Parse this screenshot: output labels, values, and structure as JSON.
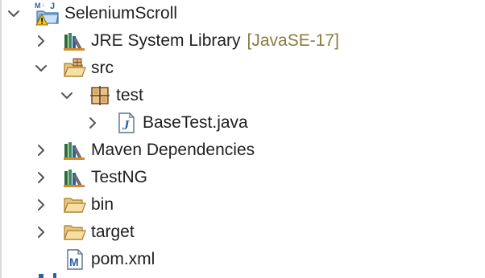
{
  "tree": {
    "items": [
      {
        "label": "SeleniumScroll",
        "decoration": "",
        "icon": "maven-project-warning-icon",
        "expanded": true
      },
      {
        "label": "JRE System Library",
        "decoration": "[JavaSE-17]",
        "icon": "library-icon",
        "expanded": false
      },
      {
        "label": "src",
        "decoration": "",
        "icon": "source-folder-icon",
        "expanded": true
      },
      {
        "label": "test",
        "decoration": "",
        "icon": "package-icon",
        "expanded": true
      },
      {
        "label": "BaseTest.java",
        "decoration": "",
        "icon": "java-file-icon",
        "expanded": false
      },
      {
        "label": "Maven Dependencies",
        "decoration": "",
        "icon": "library-icon",
        "expanded": false
      },
      {
        "label": "TestNG",
        "decoration": "",
        "icon": "library-icon",
        "expanded": false
      },
      {
        "label": "bin",
        "decoration": "",
        "icon": "folder-icon",
        "expanded": false
      },
      {
        "label": "target",
        "decoration": "",
        "icon": "folder-icon",
        "expanded": false
      },
      {
        "label": "pom.xml",
        "decoration": "",
        "icon": "maven-pom-icon",
        "expanded": false
      }
    ]
  },
  "colors": {
    "decoration": "#8b7a3e",
    "chevron": "#555555",
    "folder_fill": "#f6dfa3",
    "folder_stroke": "#b58d3a",
    "java_blue": "#2f5fa7",
    "warning_yellow": "#f3c623"
  }
}
